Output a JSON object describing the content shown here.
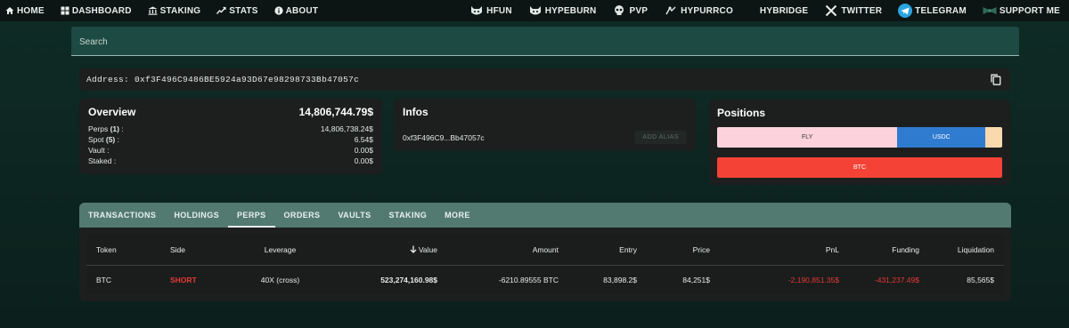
{
  "nav": {
    "left": [
      {
        "label": "HOME",
        "icon": "home-icon"
      },
      {
        "label": "DASHBOARD",
        "icon": "dashboard-icon"
      },
      {
        "label": "STAKING",
        "icon": "bank-icon"
      },
      {
        "label": "STATS",
        "icon": "trend-icon"
      },
      {
        "label": "ABOUT",
        "icon": "info-icon"
      }
    ],
    "right": [
      {
        "label": "HFUN",
        "icon": "cat-icon"
      },
      {
        "label": "HYPEBURN",
        "icon": "cat-icon"
      },
      {
        "label": "PVP",
        "icon": "skull-icon"
      },
      {
        "label": "HYPURRCO",
        "icon": "cat-icon"
      },
      {
        "label": "HYBRIDGE",
        "icon": ""
      },
      {
        "label": "TWITTER",
        "icon": "x-icon"
      },
      {
        "label": "TELEGRAM",
        "icon": "telegram-icon"
      },
      {
        "label": "SUPPORT ME",
        "icon": "bowtie-icon"
      }
    ]
  },
  "search": {
    "placeholder": "Search"
  },
  "address": {
    "label": "Address:",
    "value": "0xf3F496C9486BE5924a93D67e98298733Bb47057c"
  },
  "overview": {
    "title": "Overview",
    "total": "14,806,744.79$",
    "rows": [
      {
        "label": "Perps",
        "count": "(1)",
        "value": "14,806,738.24$"
      },
      {
        "label": "Spot",
        "count": "(5)",
        "value": "6.54$"
      },
      {
        "label": "Vault",
        "count": "",
        "value": "0.00$"
      },
      {
        "label": "Staked",
        "count": "",
        "value": "0.00$"
      }
    ]
  },
  "infos": {
    "title": "Infos",
    "short_address": "0xf3F496C9...Bb47057c",
    "alias_button": "ADD ALIAS"
  },
  "positions": {
    "title": "Positions",
    "bar": [
      {
        "label": "FLY",
        "share": 0.632,
        "color": "#fcd3dc",
        "text_color": "#333333"
      },
      {
        "label": "USDC",
        "share": 0.31,
        "color": "#2f7bd0",
        "text_color": "#ffffff"
      },
      {
        "label": "",
        "share": 0.058,
        "color": "#fbd9ae",
        "text_color": "#333333"
      }
    ],
    "btc_label": "BTC"
  },
  "tabs": [
    "TRANSACTIONS",
    "HOLDINGS",
    "PERPS",
    "ORDERS",
    "VAULTS",
    "STAKING",
    "MORE"
  ],
  "active_tab": "PERPS",
  "table": {
    "headers": [
      "Token",
      "Side",
      "Leverage",
      "Value",
      "Amount",
      "Entry",
      "Price",
      "PnL",
      "Funding",
      "Liquidation"
    ],
    "sort_column": "Value",
    "rows": [
      {
        "token": "BTC",
        "side": "SHORT",
        "leverage": "40X (cross)",
        "value": "523,274,160.98$",
        "amount": "-6210.89555 BTC",
        "entry": "83,898.2$",
        "price": "84,251$",
        "pnl": "-2,190,851.35$",
        "funding": "-431,237.49$",
        "liquidation": "85,565$"
      }
    ]
  },
  "colors": {
    "accent_tab": "#527a70",
    "negative": "#e53935",
    "btc_bar": "#f44336"
  }
}
